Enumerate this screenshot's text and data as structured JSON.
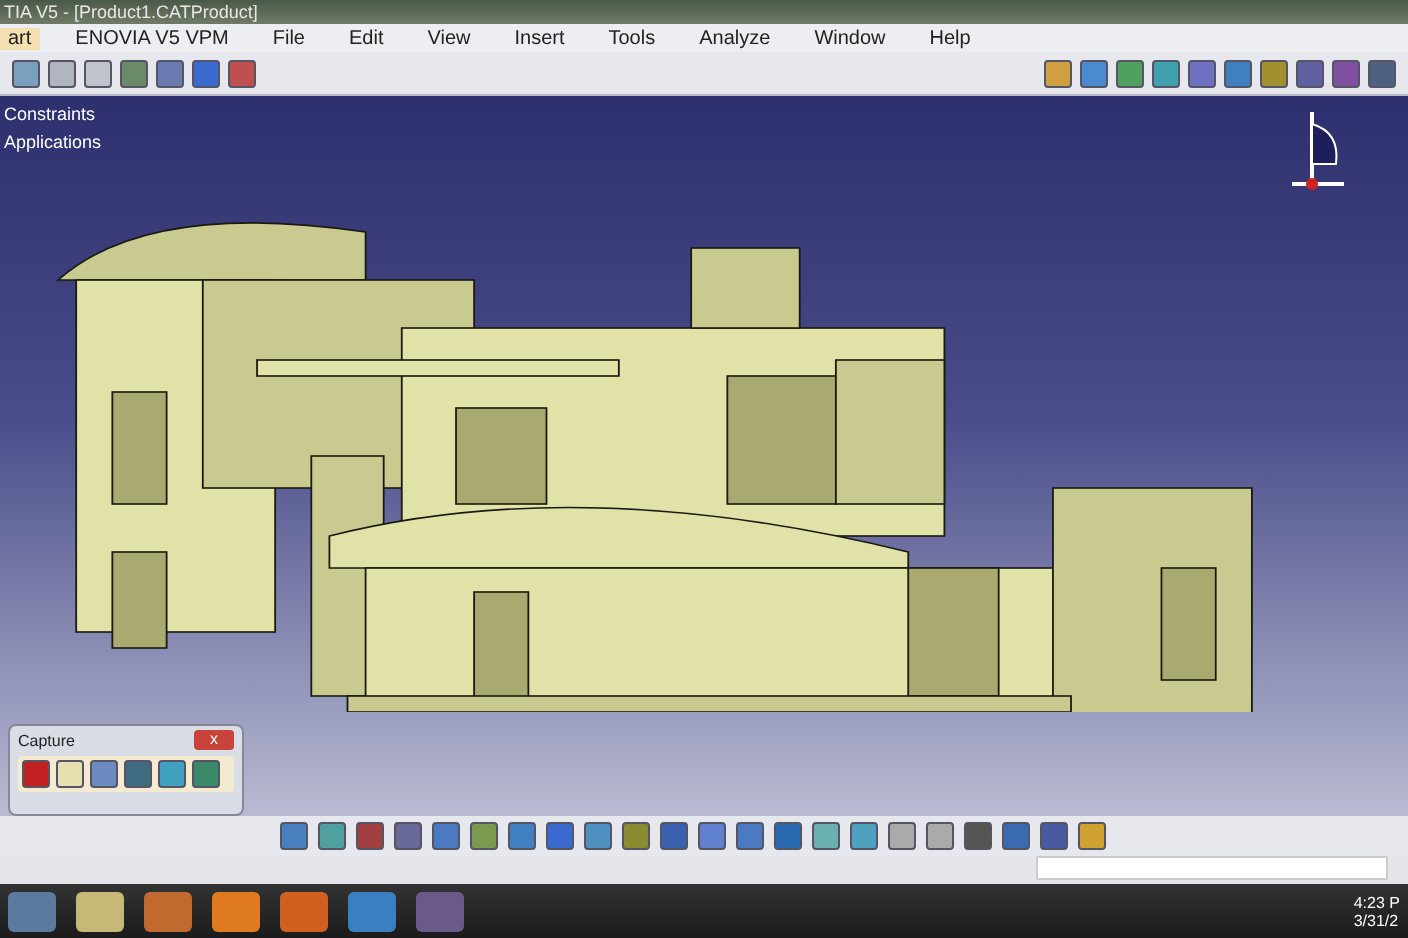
{
  "window": {
    "title": "TIA V5 - [Product1.CATProduct]"
  },
  "menu_bar": [
    {
      "label": "art",
      "selected": true
    },
    {
      "label": "ENOVIA V5 VPM",
      "selected": false
    },
    {
      "label": "File",
      "selected": false
    },
    {
      "label": "Edit",
      "selected": false
    },
    {
      "label": "View",
      "selected": false
    },
    {
      "label": "Insert",
      "selected": false
    },
    {
      "label": "Tools",
      "selected": false
    },
    {
      "label": "Analyze",
      "selected": false
    },
    {
      "label": "Window",
      "selected": false
    },
    {
      "label": "Help",
      "selected": false
    }
  ],
  "tree": [
    "Constraints",
    "Applications"
  ],
  "capture_panel": {
    "title": "Capture",
    "close": "x"
  },
  "taskbar": {
    "time": "4:23 P",
    "date": "3/31/2"
  }
}
